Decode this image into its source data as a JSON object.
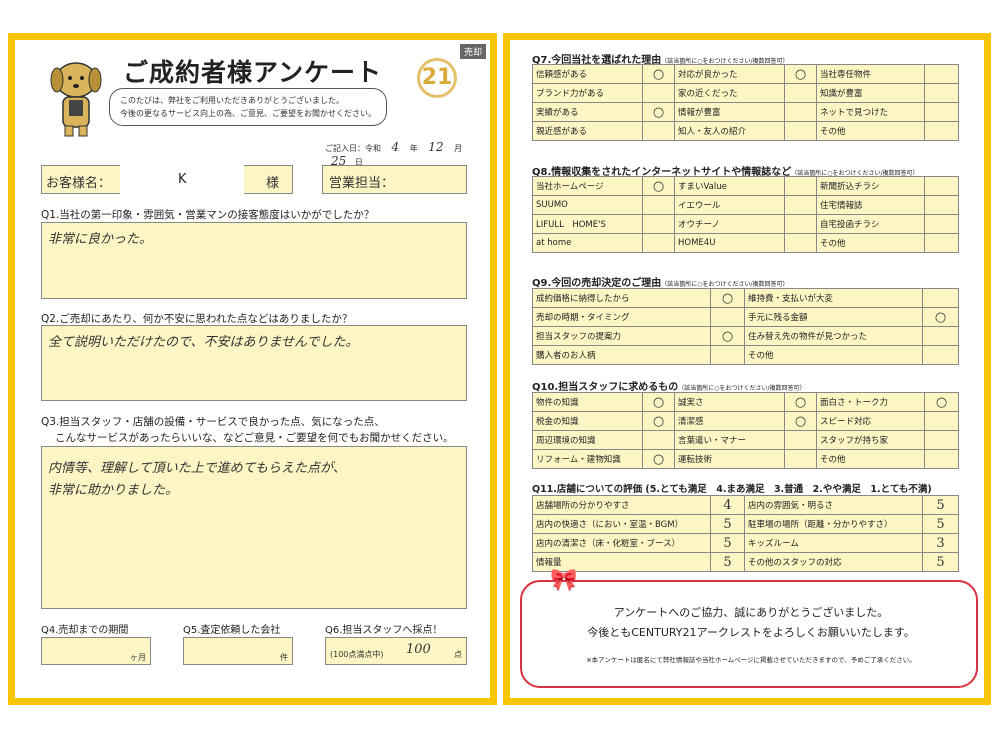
{
  "left": {
    "tag": "売却",
    "title": "ご成約者様アンケート",
    "logo": "21",
    "greeting": [
      "このたびは、弊社をご利用いただきありがとうございました。",
      "今後の更なるサービス向上の為、ご意見、ご要望をお聞かせください。"
    ],
    "fill_date": {
      "label": "ご記入日：令和",
      "year": "4",
      "y": "年",
      "month": "12",
      "m": "月",
      "day": "25",
      "d": "日"
    },
    "customer_label": "お客様名：",
    "customer_name": "K",
    "honorific": "様",
    "staff_label": "営業担当：",
    "q1": {
      "question": "Q1.当社の第一印象・雰囲気・営業マンの接客態度はいかがでしたか？",
      "answer": "非常に良かった。"
    },
    "q2": {
      "question": "Q2.ご売却にあたり、何か不安に思われた点などはありましたか？",
      "answer": "全て説明いただけたので、不安はありませんでした。"
    },
    "q3": {
      "question_1": "Q3.担当スタッフ・店舗の設備・サービスで良かった点、気になった点、",
      "question_2": "こんなサービスがあったらいいな、などご意見・ご要望を何でもお聞かせください。",
      "answer_1": "内情等、理解して頂いた上で進めてもらえた点が、",
      "answer_2": "非常に助かりました。"
    },
    "q4": {
      "label": "Q4.売却までの期間",
      "unit": "ヶ月",
      "value": ""
    },
    "q5": {
      "label": "Q5.査定依頼した会社",
      "unit": "件",
      "value": ""
    },
    "q6": {
      "label": "Q6.担当スタッフへ採点！",
      "prefix": "(100点満点中)",
      "value": "100",
      "unit": "点"
    }
  },
  "right": {
    "q7": {
      "title": "Q7.今回当社を選ばれた理由",
      "note": "（該当箇所に○をおつけください/複数回答可）",
      "rows": [
        [
          "信頼感がある",
          "○",
          "対応が良かった",
          "○",
          "当社専任物件",
          ""
        ],
        [
          "ブランド力がある",
          "",
          "家の近くだった",
          "",
          "知識が豊富",
          ""
        ],
        [
          "実績がある",
          "○",
          "情報が豊富",
          "",
          "ネットで見つけた",
          ""
        ],
        [
          "親近感がある",
          "",
          "知人・友人の紹介",
          "",
          "その他",
          ""
        ]
      ]
    },
    "q8": {
      "title": "Q8.情報収集をされたインターネットサイトや情報誌など",
      "note": "（該当箇所に○をおつけください/複数回答可）",
      "rows": [
        [
          "当社ホームページ",
          "○",
          "すまいValue",
          "",
          "新聞折込チラシ",
          ""
        ],
        [
          "SUUMO",
          "",
          "イエウール",
          "",
          "住宅情報誌",
          ""
        ],
        [
          "LIFULL　HOME'S",
          "",
          "オウチーノ",
          "",
          "自宅投函チラシ",
          ""
        ],
        [
          "at home",
          "",
          "HOME4U",
          "",
          "その他",
          ""
        ]
      ]
    },
    "q9": {
      "title": "Q9.今回の売却決定のご理由",
      "note": "（該当箇所に○をおつけください/複数回答可）",
      "rows": [
        [
          "成約価格に納得したから",
          "○",
          "維持費・支払いが大変",
          ""
        ],
        [
          "売却の時期・タイミング",
          "",
          "手元に残る金額",
          "○"
        ],
        [
          "担当スタッフの提案力",
          "○",
          "住み替え先の物件が見つかった",
          ""
        ],
        [
          "購入者のお人柄",
          "",
          "その他",
          ""
        ]
      ]
    },
    "q10": {
      "title": "Q10.担当スタッフに求めるもの",
      "note": "（該当箇所に○をおつけください/複数回答可）",
      "rows": [
        [
          "物件の知識",
          "○",
          "誠実さ",
          "○",
          "面白さ・トーク力",
          "○"
        ],
        [
          "税金の知識",
          "○",
          "清潔感",
          "○",
          "スピード対応",
          ""
        ],
        [
          "周辺環境の知識",
          "",
          "言葉遣い・マナー",
          "",
          "スタッフが持ち家",
          ""
        ],
        [
          "リフォーム・建物知識",
          "○",
          "運転技術",
          "",
          "その他",
          ""
        ]
      ]
    },
    "q11": {
      "title": "Q11.店舗についての評価 (5.とても満足　4.まあ満足　3.普通　2.やや満足　1.とても不満)",
      "rows": [
        [
          "店舗場所の分かりやすさ",
          "4",
          "店内の雰囲気・明るさ",
          "5"
        ],
        [
          "店内の快適さ（におい・室温・BGM）",
          "5",
          "駐車場の場所（距離・分かりやすさ）",
          "5"
        ],
        [
          "店内の清潔さ（床・化粧室・ブース）",
          "5",
          "キッズルーム",
          "3"
        ],
        [
          "情報量",
          "5",
          "その他のスタッフの対応",
          "5"
        ]
      ]
    },
    "thanks": {
      "line1": "アンケートへのご協力、誠にありがとうございました。",
      "line2": "今後ともCENTURY21アークレストをよろしくお願いいたします。",
      "note": "※本アンケートは匿名にて弊社情報誌や当社ホームページに掲載させていただきますので、予めご了承ください。"
    }
  }
}
